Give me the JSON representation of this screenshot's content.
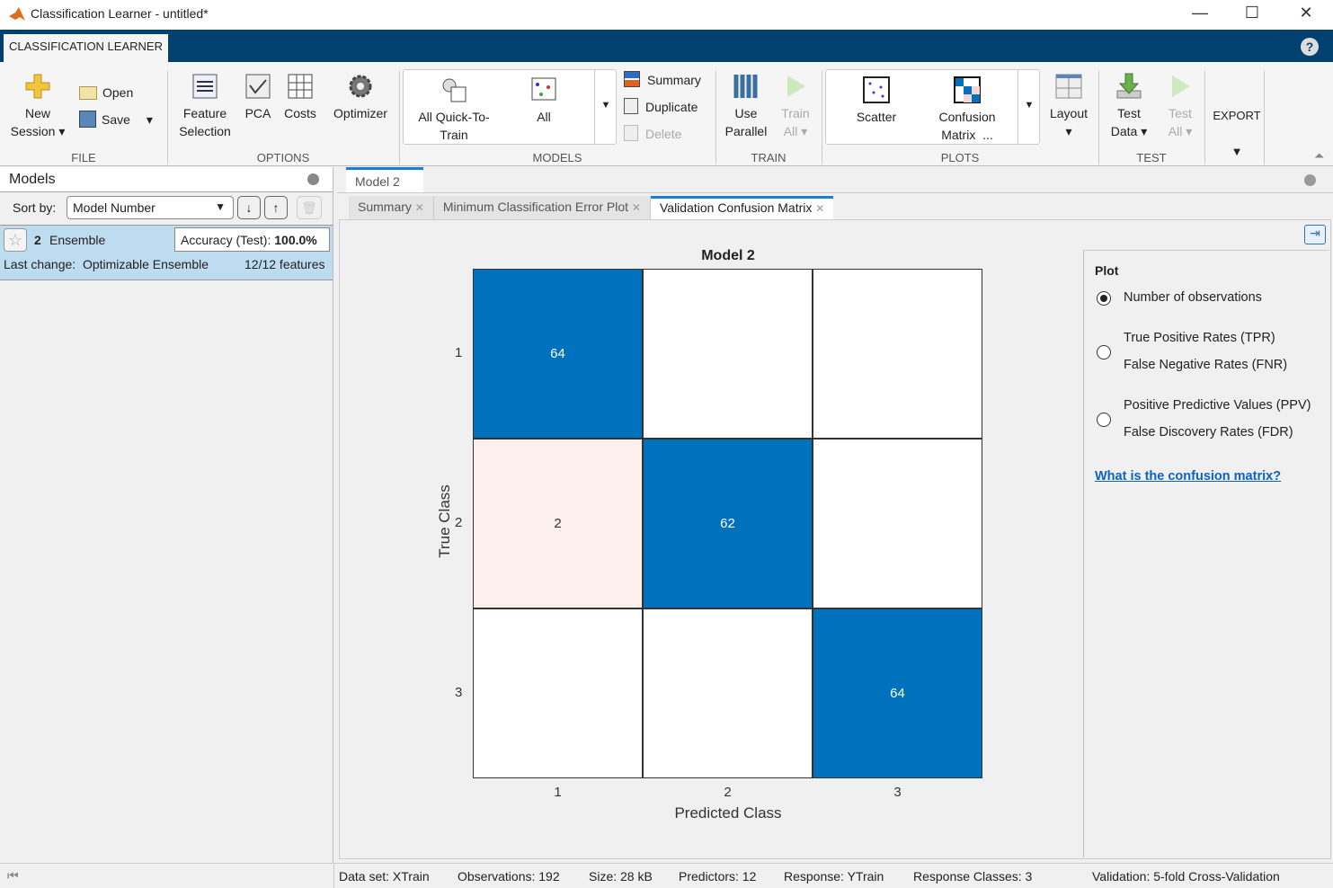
{
  "window": {
    "title": "Classification Learner - untitled*",
    "minimize": "—",
    "maximize": "☐",
    "close": "✕"
  },
  "app_tab": "CLASSIFICATION LEARNER",
  "help": "?",
  "ribbon": {
    "file": {
      "label": "FILE",
      "new_session": [
        "New",
        "Session"
      ],
      "open": "Open",
      "save": "Save"
    },
    "options": {
      "label": "OPTIONS",
      "feature_selection": [
        "Feature",
        "Selection"
      ],
      "pca": "PCA",
      "costs": "Costs",
      "optimizer": "Optimizer"
    },
    "models": {
      "label": "MODELS",
      "all_quick": [
        "All Quick-To-",
        "Train"
      ],
      "all": "All",
      "summary": "Summary",
      "duplicate": "Duplicate",
      "delete": "Delete"
    },
    "train": {
      "label": "TRAIN",
      "use_parallel": [
        "Use",
        "Parallel"
      ],
      "train_all": [
        "Train",
        "All"
      ]
    },
    "plots": {
      "label": "PLOTS",
      "scatter": "Scatter",
      "confusion": [
        "Confusion",
        "Matrix",
        "..."
      ]
    },
    "layout": "Layout",
    "test": {
      "label": "TEST",
      "test_data": [
        "Test",
        "Data"
      ],
      "test_all": [
        "Test",
        "All"
      ]
    },
    "export": "EXPORT"
  },
  "models_panel": {
    "title": "Models",
    "sort_label": "Sort by:",
    "sort_value": "Model Number",
    "model": {
      "number": "2",
      "name": "Ensemble",
      "accuracy_label": "Accuracy (Test):",
      "accuracy": "100.0%",
      "last_change": "Last change:  Optimizable Ensemble",
      "features": "12/12 features"
    }
  },
  "doc_tab": "Model 2",
  "plot_tabs": [
    {
      "label": "Summary"
    },
    {
      "label": "Minimum Classification Error Plot"
    },
    {
      "label": "Validation Confusion Matrix",
      "active": true
    }
  ],
  "chart_data": {
    "type": "heatmap",
    "title": "Model 2",
    "xlabel": "Predicted Class",
    "ylabel": "True Class",
    "x_categories": [
      "1",
      "2",
      "3"
    ],
    "y_categories": [
      "1",
      "2",
      "3"
    ],
    "values": [
      [
        64,
        null,
        null
      ],
      [
        2,
        62,
        null
      ],
      [
        null,
        null,
        64
      ]
    ],
    "colors": {
      "diagonal": "#0072BD",
      "off_diagonal": "#FBF0EB"
    }
  },
  "plot_options": {
    "title": "Plot",
    "options": [
      {
        "lines": [
          "Number of observations"
        ],
        "selected": true
      },
      {
        "lines": [
          "True Positive Rates (TPR)",
          "False Negative Rates (FNR)"
        ],
        "selected": false
      },
      {
        "lines": [
          "Positive Predictive Values (PPV)",
          "False Discovery Rates (FDR)"
        ],
        "selected": false
      }
    ],
    "link": "What is the confusion matrix?"
  },
  "status": {
    "dataset": "Data set: XTrain",
    "observations": "Observations: 192",
    "size": "Size: 28 kB",
    "predictors": "Predictors: 12",
    "response": "Response: YTrain",
    "classes": "Response Classes: 3",
    "validation": "Validation: 5-fold Cross-Validation"
  }
}
